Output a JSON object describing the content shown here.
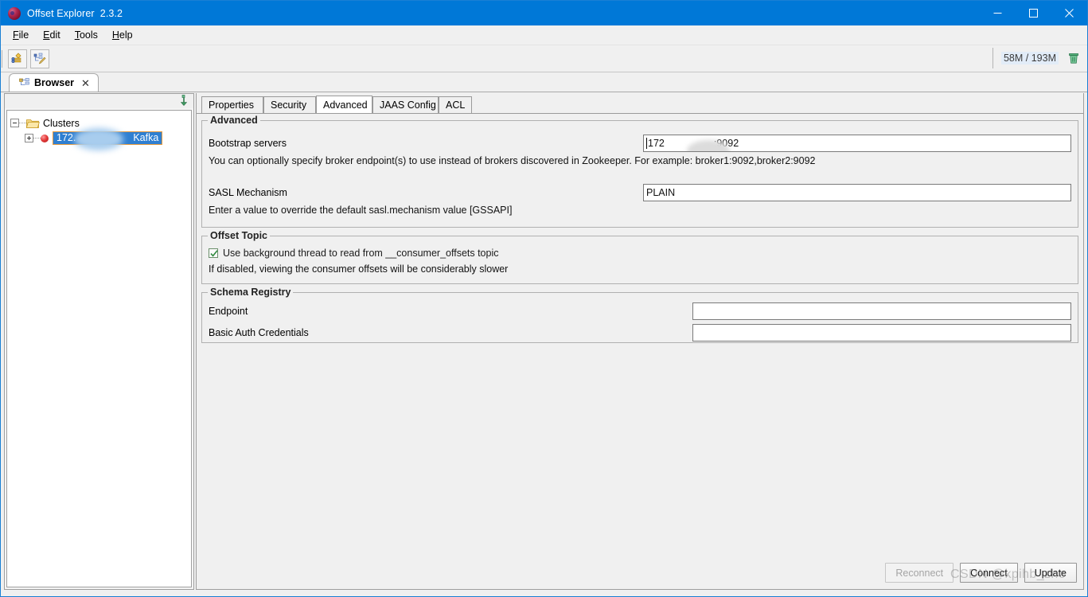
{
  "window": {
    "title": "Offset Explorer  2.3.2",
    "app_icon": "sphere-icon",
    "controls": {
      "minimize": "minimize-icon",
      "maximize": "maximize-icon",
      "close": "close-icon"
    }
  },
  "menubar": {
    "items": [
      {
        "label": "File",
        "mnemonic": "F"
      },
      {
        "label": "Edit",
        "mnemonic": "E"
      },
      {
        "label": "Tools",
        "mnemonic": "T"
      },
      {
        "label": "Help",
        "mnemonic": "H"
      }
    ]
  },
  "toolbar": {
    "buttons": [
      {
        "name": "add-cluster-icon"
      },
      {
        "name": "edit-cluster-icon"
      }
    ],
    "memory": {
      "text": "58M / 193M",
      "gc_icon": "trash-icon"
    }
  },
  "dock_tabs": [
    {
      "label": "Browser",
      "icon": "browser-tree-icon",
      "close": "✕",
      "active": true
    }
  ],
  "tree": {
    "minimize_icon": "collapse-down-arrow-icon",
    "root": {
      "label": "Clusters",
      "icon": "open-folder-icon",
      "expanded": true
    },
    "nodes": [
      {
        "label_prefix": "172.",
        "label_suffix": "Kafka",
        "icon": "cluster-status-dot",
        "selected": true,
        "expanded": false
      }
    ]
  },
  "form": {
    "tabs": [
      {
        "label": "Properties",
        "active": false
      },
      {
        "label": "Security",
        "active": false
      },
      {
        "label": "Advanced",
        "active": true
      },
      {
        "label": "JAAS Config",
        "active": false
      },
      {
        "label": "ACL",
        "active": false
      }
    ],
    "advanced_group": {
      "title": "Advanced",
      "bootstrap": {
        "label": "Bootstrap servers",
        "value_prefix": "172",
        "value_suffix": ":9092",
        "hint": "You can optionally specify broker endpoint(s) to use instead of brokers discovered in Zookeeper. For example: broker1:9092,broker2:9092"
      },
      "sasl": {
        "label": "SASL Mechanism",
        "value": "PLAIN",
        "hint": "Enter a value to override the default sasl.mechanism value [GSSAPI]"
      }
    },
    "offset_topic_group": {
      "title": "Offset Topic",
      "checkbox": {
        "label": "Use background thread to read from __consumer_offsets topic",
        "checked": true
      },
      "hint": "If disabled, viewing the consumer offsets will be considerably slower"
    },
    "schema_registry_group": {
      "title": "Schema Registry",
      "fields": [
        {
          "label": "Endpoint",
          "value": ""
        },
        {
          "label": "Basic Auth Credentials",
          "value": ""
        }
      ]
    },
    "footer_buttons": [
      {
        "label": "Reconnect",
        "disabled": true
      },
      {
        "label": "Connect",
        "disabled": false
      },
      {
        "label": "Update",
        "disabled": false
      }
    ]
  },
  "watermark": {
    "text": "CSDN @kpihb_zhe"
  },
  "colors": {
    "title_bar": "#0078d7",
    "panel_bg": "#f0f0f0",
    "selection": "#2f7fd1",
    "selection_border": "#e79a3c",
    "status_dot": "#e33b3b"
  }
}
